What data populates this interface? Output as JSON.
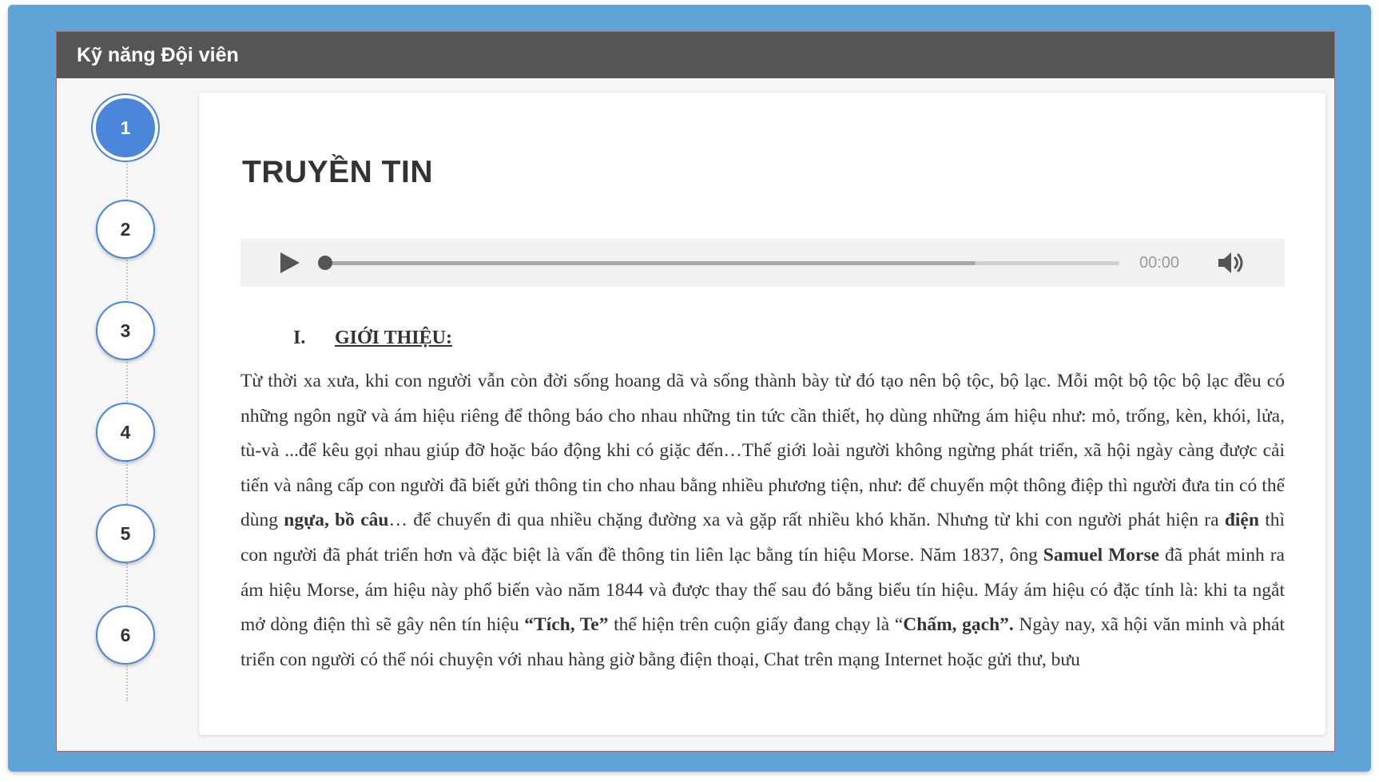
{
  "window": {
    "title": "Kỹ năng Đội viên"
  },
  "stepper": {
    "active_index": 0,
    "steps": [
      "1",
      "2",
      "3",
      "4",
      "5",
      "6"
    ]
  },
  "lesson": {
    "title": "TRUYỀN TIN",
    "audio": {
      "time": "00:00",
      "progress": 0,
      "buffered": 0.82
    },
    "section": {
      "number": "I.",
      "label": "GIỚI THIỆU:"
    },
    "paragraph": [
      {
        "text": "Từ thời xa xưa, khi con người vẫn còn đời sống hoang dã và sống thành bày từ đó tạo nên bộ tộc, bộ lạc. Mỗi một bộ tộc bộ lạc đều có những ngôn ngữ và ám hiệu riêng để thông báo cho nhau những tin tức cần thiết, họ dùng những ám hiệu như: mỏ, trống, kèn, khói, lửa, tù-và ...để kêu gọi nhau giúp đỡ hoặc báo động khi có giặc đến…Thế giới loài người không ngừng phát triển, xã hội ngày càng được cải tiến và nâng cấp con người đã biết gửi thông tin cho nhau bằng nhiều phương tiện, như: để chuyển một thông điệp thì người đưa tin có thể dùng ",
        "bold": false
      },
      {
        "text": "ngựa, bồ câu",
        "bold": true
      },
      {
        "text": "… để chuyển đi qua nhiều chặng đường xa và gặp rất nhiều khó khăn. Nhưng từ khi con người phát hiện ra ",
        "bold": false
      },
      {
        "text": "điện",
        "bold": true
      },
      {
        "text": " thì con người đã phát triển hơn và đặc biệt là vấn đề thông tin liên lạc bằng tín hiệu Morse. Năm 1837, ông ",
        "bold": false
      },
      {
        "text": "Samuel Morse",
        "bold": true
      },
      {
        "text": " đã phát minh ra ám hiệu Morse, ám hiệu này phổ biến vào năm 1844 và được thay thế sau đó bằng biểu tín hiệu. Máy ám hiệu có đặc tính là: khi ta ngắt mở dòng điện thì sẽ gây nên tín hiệu ",
        "bold": false
      },
      {
        "text": "“Tích, Te”",
        "bold": true
      },
      {
        "text": " thể hiện trên cuộn giấy đang chạy là “",
        "bold": false
      },
      {
        "text": "Chấm, gạch”.",
        "bold": true
      },
      {
        "text": " Ngày nay, xã hội văn minh và phát triển con người có thể nói chuyện với nhau hàng giờ bằng điện thoại, Chat trên mạng Internet hoặc gửi thư, bưu",
        "bold": false
      }
    ]
  },
  "colors": {
    "frame_bg": "#5ea4d6",
    "titlebar_bg": "#555555",
    "accent": "#4a86d9",
    "window_border": "#d9534f"
  },
  "icons": {
    "play": "play-icon",
    "volume": "volume-icon"
  }
}
